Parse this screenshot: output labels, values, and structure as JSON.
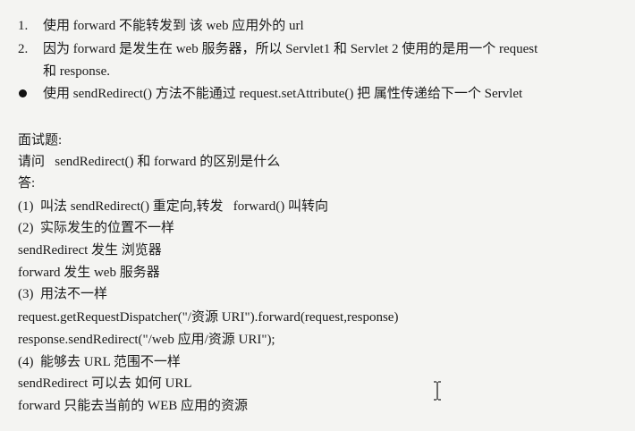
{
  "notes": [
    {
      "marker": "1.",
      "text": "使用 forward 不能转发到 该 web 应用外的 url"
    },
    {
      "marker": "2.",
      "text": "因为 forward 是发生在 web 服务器，所以 Servlet1 和 Servlet 2 使用的是用一个 request"
    },
    {
      "marker": "",
      "text": "和 response."
    },
    {
      "marker": "bullet",
      "text": "使用 sendRedirect() 方法不能通过 request.setAttribute() 把 属性传递给下一个 Servlet"
    }
  ],
  "interview": {
    "heading": "面试题:",
    "question": "请问   sendRedirect() 和 forward 的区别是什么",
    "answer_label": "答:",
    "lines": [
      "(1)  叫法 sendRedirect() 重定向,转发   forward() 叫转向",
      "(2)  实际发生的位置不一样",
      "sendRedirect 发生 浏览器",
      "forward 发生 web 服务器",
      "(3)  用法不一样",
      "request.getRequestDispatcher(\"/资源 URI\").forward(request,response)",
      "response.sendRedirect(\"/web 应用/资源 URI\");",
      "(4)  能够去 URL 范围不一样",
      "sendRedirect 可以去 如何 URL",
      "forward 只能去当前的 WEB 应用的资源"
    ]
  }
}
